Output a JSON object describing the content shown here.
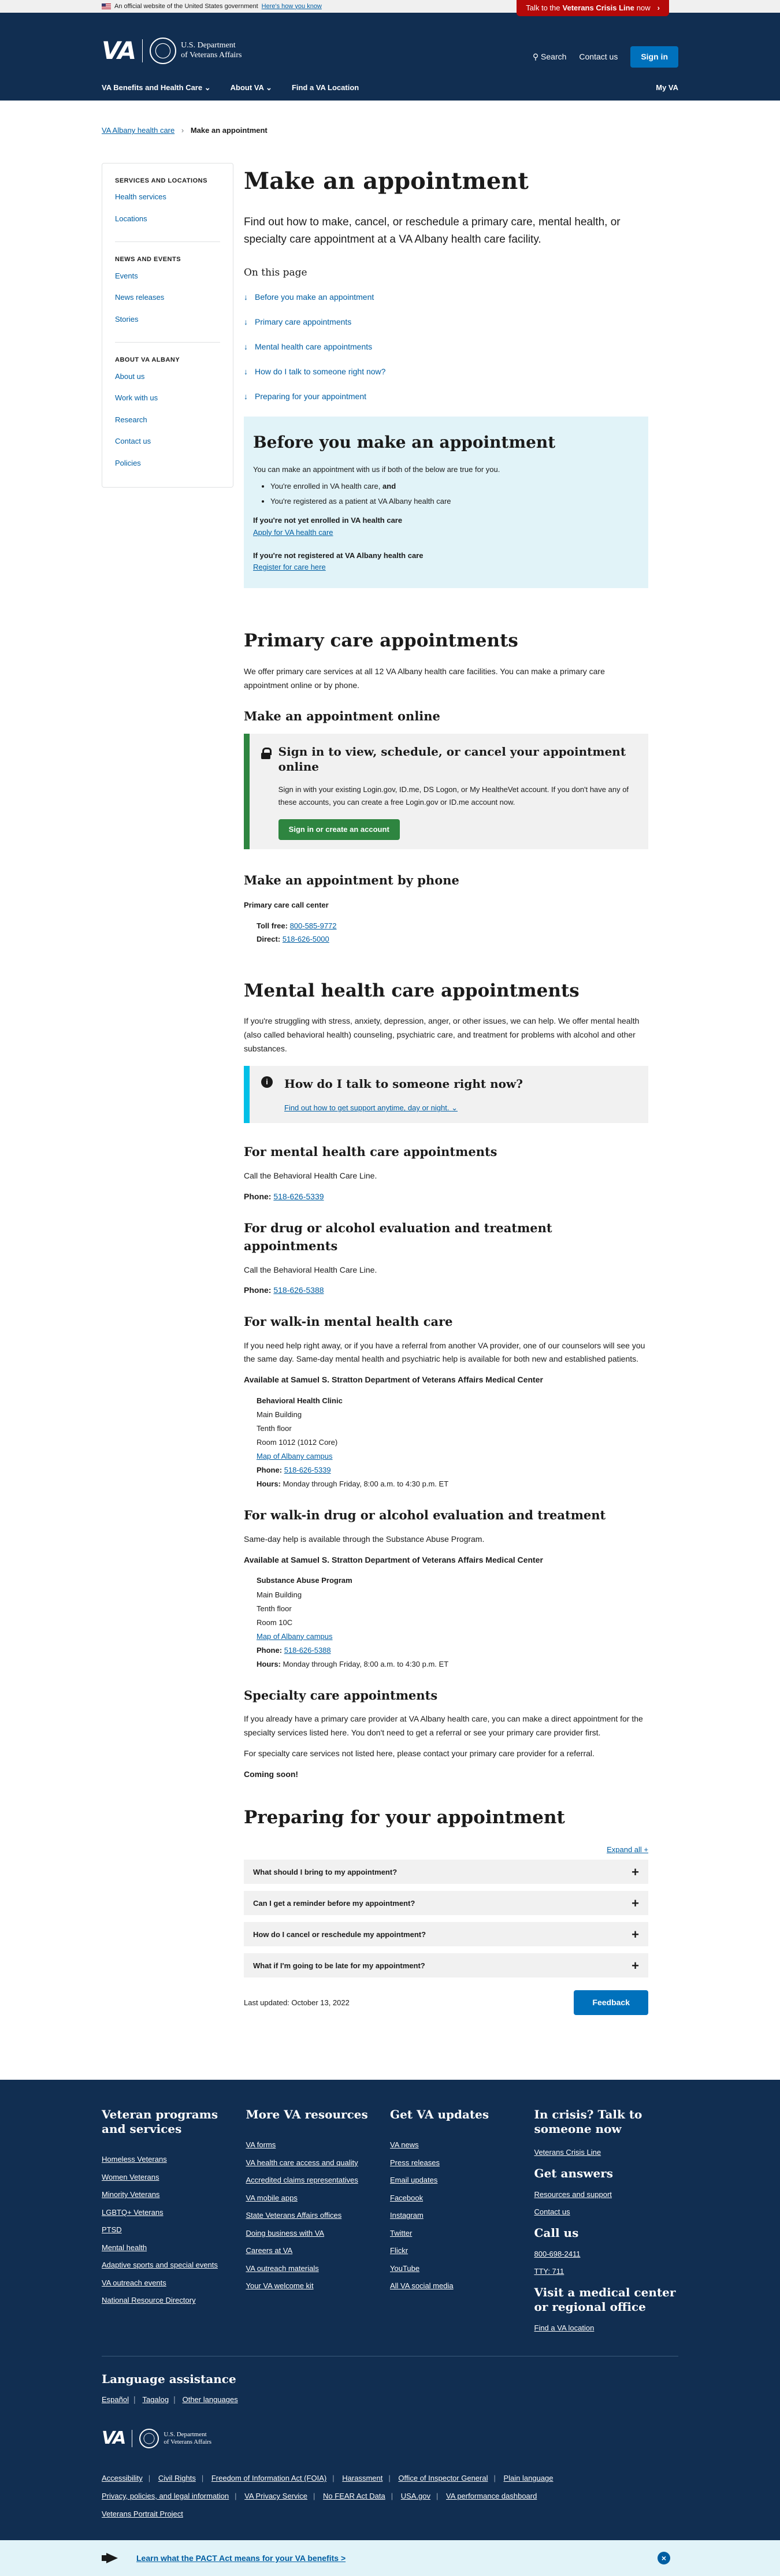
{
  "banner": {
    "official_text": "An official website of the United States government",
    "how_link": "Here's how you know",
    "crisis_prefix": "Talk to the",
    "crisis_bold": "Veterans Crisis Line",
    "crisis_suffix": "now"
  },
  "header": {
    "logo": "VA",
    "dept_line1": "U.S. Department",
    "dept_line2": "of Veterans Affairs",
    "search": "Search",
    "contact": "Contact us",
    "signin": "Sign in",
    "nav": [
      "VA Benefits and Health Care",
      "About VA",
      "Find a VA Location"
    ],
    "myva": "My VA"
  },
  "breadcrumb": {
    "parent": "VA Albany health care",
    "current": "Make an appointment"
  },
  "sidebar": {
    "groups": [
      {
        "heading": "SERVICES AND LOCATIONS",
        "links": [
          "Health services",
          "Locations"
        ]
      },
      {
        "heading": "NEWS AND EVENTS",
        "links": [
          "Events",
          "News releases",
          "Stories"
        ]
      },
      {
        "heading": "ABOUT VA ALBANY",
        "links": [
          "About us",
          "Work with us",
          "Research",
          "Contact us",
          "Policies"
        ]
      }
    ]
  },
  "page": {
    "title": "Make an appointment",
    "intro": "Find out how to make, cancel, or reschedule a primary care, mental health, or specialty care appointment at a VA Albany health care facility.",
    "on_this_page": "On this page",
    "jump_links": [
      "Before you make an appointment",
      "Primary care appointments",
      "Mental health care appointments",
      "How do I talk to someone right now?",
      "Preparing for your appointment"
    ]
  },
  "before": {
    "title": "Before you make an appointment",
    "lead": "You can make an appointment with us if both of the below are true for you.",
    "bullet1": "You're enrolled in VA health care,",
    "bullet1_bold": "and",
    "bullet2": "You're registered as a patient at VA Albany health care",
    "q1": "If you're not yet enrolled in VA health care",
    "a1": "Apply for VA health care",
    "q2": "If you're not registered at VA Albany health care",
    "a2": "Register for care here"
  },
  "primary": {
    "title": "Primary care appointments",
    "body": "We offer primary care services at all 12 VA Albany health care facilities. You can make a primary care appointment online or by phone.",
    "online_title": "Make an appointment online",
    "signin_title": "Sign in to view, schedule, or cancel your appointment online",
    "signin_body": "Sign in with your existing Login.gov, ID.me, DS Logon, or My HealtheVet account. If you don't have any of these accounts, you can create a free Login.gov or ID.me account now.",
    "signin_button": "Sign in or create an account",
    "phone_title": "Make an appointment by phone",
    "callcenter": "Primary care call center",
    "tollfree_label": "Toll free:",
    "tollfree": "800-585-9772",
    "direct_label": "Direct:",
    "direct": "518-626-5000"
  },
  "mental": {
    "title": "Mental health care appointments",
    "body": "If you're struggling with stress, anxiety, depression, anger, or other issues, we can help. We offer mental health (also called behavioral health) counseling, psychiatric care, and treatment for problems with alcohol and other substances.",
    "talk_title": "How do I talk to someone right now?",
    "talk_link": "Find out how to get support anytime, day or night.",
    "mh_title": "For mental health care appointments",
    "mh_body": "Call the Behavioral Health Care Line.",
    "phone_label": "Phone:",
    "mh_phone": "518-626-5339",
    "drug_title": "For drug or alcohol evaluation and treatment appointments",
    "drug_body": "Call  the Behavioral Health Care Line.",
    "drug_phone": "518-626-5388",
    "walk_title": "For walk-in mental health care",
    "walk_body": "If you need help right away, or if you have a referral from another VA provider, one of our counselors will see you the same day. Same-day mental health and psychiatric help is available for both new and established patients.",
    "available": "Available at Samuel S. Stratton Department of Veterans Affairs Medical Center",
    "clinic": "Behavioral Health Clinic",
    "clinic_lines": [
      "Main Building",
      "Tenth floor",
      "Room 1012 (1012 Core)"
    ],
    "map": "Map of Albany campus",
    "clinic_phone": "518-626-5339",
    "hours_label": "Hours:",
    "hours": "Monday through Friday, 8:00 a.m. to 4:30 p.m. ET",
    "walkdrug_title": "For walk-in drug or alcohol evaluation and treatment",
    "walkdrug_body": "Same-day help is available through the Substance Abuse Program.",
    "program": "Substance Abuse Program",
    "program_lines": [
      "Main Building",
      "Tenth floor",
      "Room 10C"
    ],
    "program_phone": "518-626-5388"
  },
  "specialty": {
    "title": "Specialty care appointments",
    "body1": "If you already have a primary care provider at VA Albany health care, you can make a direct appointment for the specialty services listed here. You don't need to get a referral or see your primary care provider first.",
    "body2": "For specialty care services not listed here, please contact your primary care provider for a referral.",
    "soon": "Coming soon!"
  },
  "preparing": {
    "title": "Preparing for your appointment",
    "expand": "Expand all +",
    "items": [
      "What should I bring to my appointment?",
      "Can I get a reminder before my appointment?",
      "How do I cancel or reschedule my appointment?",
      "What if I'm going to be late for my appointment?"
    ],
    "updated": "Last updated: October 13, 2022",
    "feedback": "Feedback"
  },
  "footer": {
    "col1": {
      "heading": "Veteran programs and services",
      "links": [
        "Homeless Veterans",
        "Women Veterans",
        "Minority Veterans",
        "LGBTQ+ Veterans",
        "PTSD",
        "Mental health",
        "Adaptive sports and special events",
        "VA outreach events",
        "National Resource Directory"
      ]
    },
    "col2": {
      "heading": "More VA resources",
      "links": [
        "VA forms",
        "VA health care access and quality",
        "Accredited claims representatives",
        "VA mobile apps",
        "State Veterans Affairs offices",
        "Doing business with VA",
        "Careers at VA",
        "VA outreach materials",
        "Your VA welcome kit"
      ]
    },
    "col3": {
      "heading": "Get VA updates",
      "links": [
        "VA news",
        "Press releases",
        "Email updates",
        "Facebook",
        "Instagram",
        "Twitter",
        "Flickr",
        "YouTube",
        "All VA social media"
      ]
    },
    "col4": {
      "crisis_heading": "In crisis? Talk to someone now",
      "crisis_link": "Veterans Crisis Line",
      "answers_heading": "Get answers",
      "answers_links": [
        "Resources and support",
        "Contact us"
      ],
      "call_heading": "Call us",
      "call_links": [
        "800-698-2411",
        "TTY: 711"
      ],
      "visit_heading": "Visit a medical center or regional office",
      "visit_link": "Find a VA location"
    },
    "lang_heading": "Language assistance",
    "lang_links": [
      "Español",
      "Tagalog",
      "Other languages"
    ],
    "bottom_links": [
      "Accessibility",
      "Civil Rights",
      "Freedom of Information Act (FOIA)",
      "Harassment",
      "Office of Inspector General",
      "Plain language",
      "Privacy, policies, and legal information",
      "VA Privacy Service",
      "No FEAR Act Data",
      "USA.gov",
      "VA performance dashboard",
      "Veterans Portrait Project"
    ]
  },
  "pact": {
    "text": "Learn what the PACT Act means for your VA benefits >"
  }
}
